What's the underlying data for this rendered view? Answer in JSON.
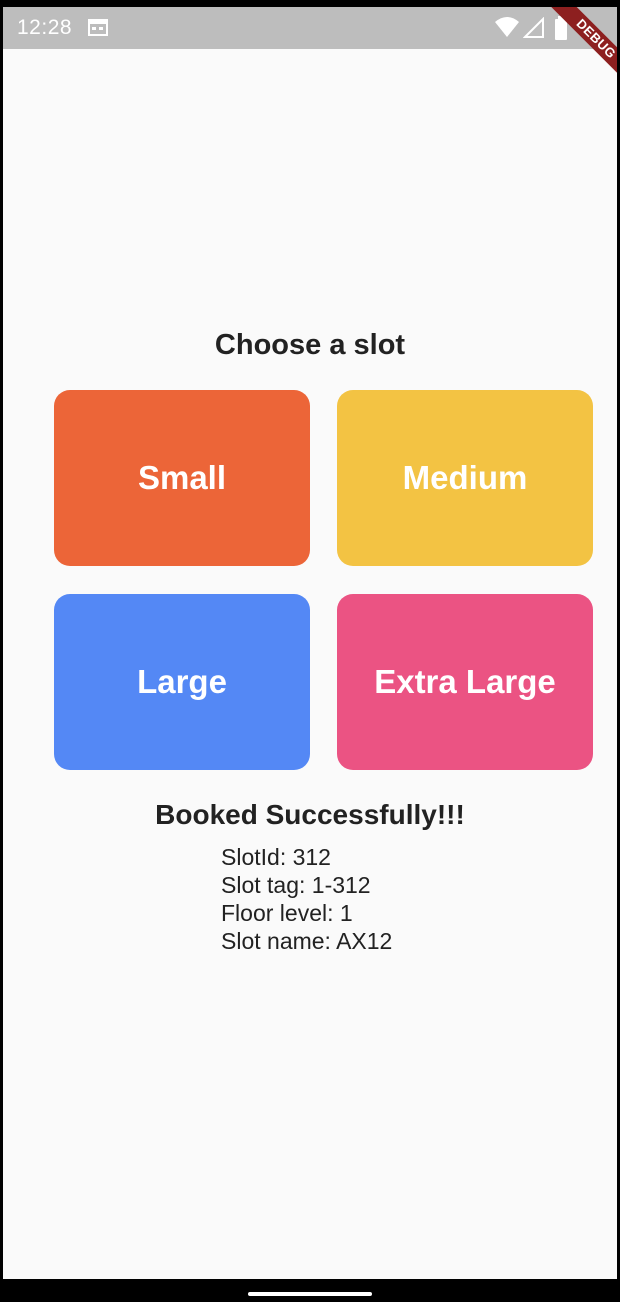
{
  "status_bar": {
    "time": "12:28",
    "icons": [
      "calendar-icon",
      "wifi-icon",
      "signal-icon",
      "battery-icon"
    ]
  },
  "debug_banner": {
    "label": "DEBUG"
  },
  "slots": {
    "title": "Choose a slot",
    "options": [
      {
        "label": "Small",
        "color": "#ec6538"
      },
      {
        "label": "Medium",
        "color": "#f3c343"
      },
      {
        "label": "Large",
        "color": "#5488f5"
      },
      {
        "label": "Extra Large",
        "color": "#eb5383"
      }
    ]
  },
  "booking": {
    "status": "Booked Successfully!!!",
    "details": [
      "SlotId: 312",
      "Slot tag: 1-312",
      "Floor level: 1",
      "Slot name: AX12"
    ]
  }
}
